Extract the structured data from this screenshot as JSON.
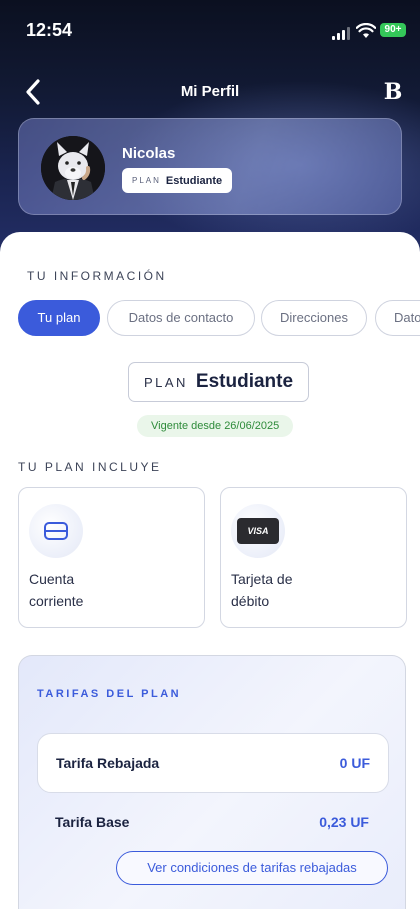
{
  "status_bar": {
    "time": "12:54",
    "battery": "90+"
  },
  "nav": {
    "title": "Mi Perfil",
    "back_icon": "chevron-left-icon",
    "brand_logo": "B"
  },
  "profile": {
    "name": "Nicolas",
    "plan_label": "PLAN",
    "plan_value": "Estudiante"
  },
  "info": {
    "section_title": "TU INFORMACIÓN",
    "tabs": [
      {
        "label": "Tu plan",
        "active": true
      },
      {
        "label": "Datos de contacto",
        "active": false
      },
      {
        "label": "Direcciones",
        "active": false
      },
      {
        "label": "Dato",
        "active": false
      }
    ]
  },
  "plan": {
    "label": "PLAN",
    "value": "Estudiante",
    "vigente": "Vigente desde 26/06/2025",
    "includes_title": "TU PLAN INCLUYE",
    "benefits": [
      {
        "icon": "card-outline-icon",
        "line1": "Cuenta",
        "line2": "corriente"
      },
      {
        "icon": "visa-card-icon",
        "icon_text": "VISA",
        "line1": "Tarjeta de",
        "line2": "débito"
      }
    ]
  },
  "tarifas": {
    "title": "TARIFAS DEL PLAN",
    "rows": [
      {
        "name": "Tarifa Rebajada",
        "value": "0 UF"
      },
      {
        "name": "Tarifa Base",
        "value": "0,23 UF"
      }
    ],
    "button_label": "Ver condiciones de tarifas rebajadas"
  },
  "colors": {
    "accent": "#3b5bdb",
    "header_dark": "#121a35",
    "success_text": "#2e8b3a"
  }
}
